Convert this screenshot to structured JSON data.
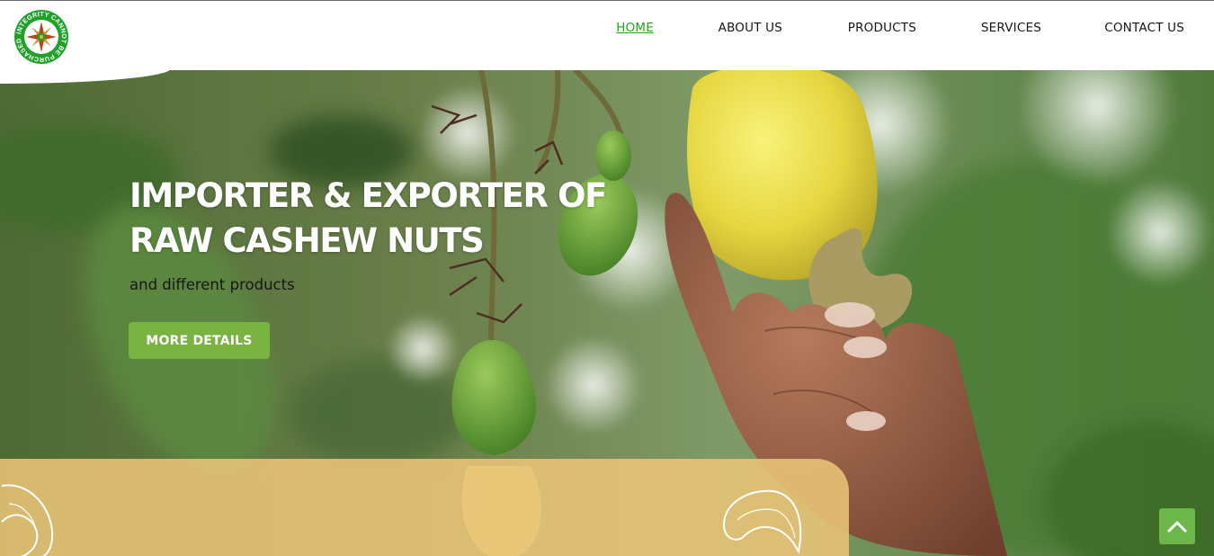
{
  "brand": {
    "logo_text": "INTEGRITY CANNOT BE PURCHASED",
    "logo_icon": "compass-star-emblem",
    "colors": {
      "ring": "#21a12a",
      "star": "#b34a1f"
    }
  },
  "nav": {
    "items": [
      {
        "label": "HOME",
        "active": true
      },
      {
        "label": "ABOUT US",
        "active": false
      },
      {
        "label": "PRODUCTS",
        "active": false
      },
      {
        "label": "SERVICES",
        "active": false
      },
      {
        "label": "CONTACT US",
        "active": false
      }
    ],
    "active_color": "#20a51d"
  },
  "hero": {
    "title_line1": "IMPORTER & EXPORTER OF",
    "title_line2": "RAW CASHEW NUTS",
    "subtitle": "and different products",
    "cta_label": "MORE DETAILS",
    "cta_color": "#79b342",
    "image": "hand-holding-cashew-apple-photo"
  },
  "band": {
    "color": "#e9c478",
    "icons": [
      "cashew-outline-icon",
      "cashew-outline-icon"
    ]
  },
  "scroll_top": {
    "icon": "chevron-up-icon",
    "color": "#6cb74a"
  }
}
